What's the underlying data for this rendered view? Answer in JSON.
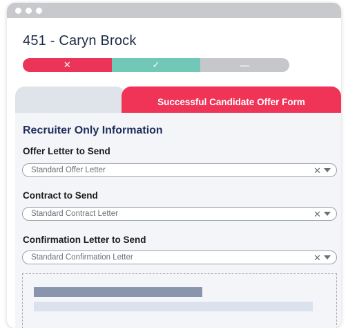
{
  "candidate": {
    "title": "451 - Caryn Brock"
  },
  "status_bar": {
    "segments": [
      {
        "icon": "x-icon",
        "glyph": "✕",
        "color": "#ea3559"
      },
      {
        "icon": "check-icon",
        "glyph": "✓",
        "color": "#72c8b6"
      },
      {
        "icon": "dash-icon",
        "glyph": "—",
        "color": "#c6c7ca"
      }
    ]
  },
  "tabs": {
    "active_label": "Successful Candidate Offer Form",
    "active_color": "#ef3458",
    "inactive_color": "#dfe3ea"
  },
  "form": {
    "heading": "Recruiter Only Information",
    "fields": [
      {
        "label": "Offer Letter to Send",
        "value": "Standard Offer Letter"
      },
      {
        "label": "Contract to Send",
        "value": "Standard Contract Letter"
      },
      {
        "label": "Confirmation Letter to Send",
        "value": "Standard Confirmation Letter"
      }
    ],
    "clear_glyph": "✕"
  }
}
